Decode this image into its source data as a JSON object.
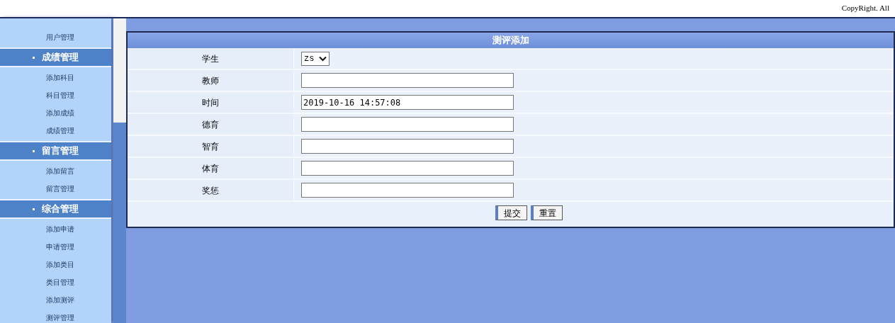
{
  "top_bar": {
    "copyright": "CopyRight. All"
  },
  "sidebar": {
    "items": [
      {
        "kind": "item",
        "label": "用户管理"
      },
      {
        "kind": "header",
        "label": "成绩管理"
      },
      {
        "kind": "item",
        "label": "添加科目"
      },
      {
        "kind": "item",
        "label": "科目管理"
      },
      {
        "kind": "item",
        "label": "添加成绩"
      },
      {
        "kind": "item",
        "label": "成绩管理"
      },
      {
        "kind": "header",
        "label": "留言管理"
      },
      {
        "kind": "item",
        "label": "添加留言"
      },
      {
        "kind": "item",
        "label": "留言管理"
      },
      {
        "kind": "header",
        "label": "综合管理"
      },
      {
        "kind": "item",
        "label": "添加申请"
      },
      {
        "kind": "item",
        "label": "申请管理"
      },
      {
        "kind": "item",
        "label": "添加类目"
      },
      {
        "kind": "item",
        "label": "类目管理"
      },
      {
        "kind": "item",
        "label": "添加测评"
      },
      {
        "kind": "item",
        "label": "测评管理"
      }
    ]
  },
  "form": {
    "title": "测评添加",
    "fields": [
      {
        "label": "学生",
        "kind": "select",
        "value": "zs"
      },
      {
        "label": "教师",
        "kind": "text"
      },
      {
        "label": "时间",
        "kind": "text",
        "value": "2019-10-16 14:57:08"
      },
      {
        "label": "德育",
        "kind": "text"
      },
      {
        "label": "智育",
        "kind": "text"
      },
      {
        "label": "体育",
        "kind": "text"
      },
      {
        "label": "奖惩",
        "kind": "text"
      }
    ],
    "buttons": [
      "提交",
      "重置"
    ]
  }
}
